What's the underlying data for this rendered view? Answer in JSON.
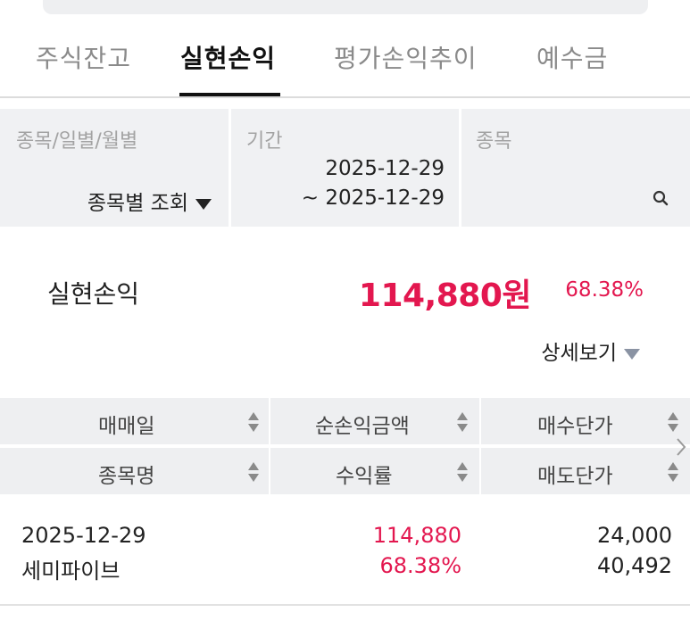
{
  "tabs": [
    {
      "label": "주식잔고",
      "active": false
    },
    {
      "label": "실현손익",
      "active": true
    },
    {
      "label": "평가손익추이",
      "active": false
    },
    {
      "label": "예수금",
      "active": false
    }
  ],
  "filters": {
    "view_type": {
      "label": "종목/일별/월별",
      "value": "종목별 조회"
    },
    "period": {
      "label": "기간",
      "start": "2025-12-29",
      "end": "~ 2025-12-29"
    },
    "stock": {
      "label": "종목",
      "search_icon": "search-icon"
    }
  },
  "summary": {
    "label": "실현손익",
    "amount": "114,880원",
    "rate": "68.38%",
    "detail_label": "상세보기"
  },
  "table": {
    "header_row1": [
      "매매일",
      "순손익금액",
      "매수단가"
    ],
    "header_row2": [
      "종목명",
      "수익률",
      "매도단가"
    ],
    "rows": [
      {
        "date": "2025-12-29",
        "name": "세미파이브",
        "net_profit": "114,880",
        "rate": "68.38%",
        "buy_price": "24,000",
        "sell_price": "40,492"
      }
    ]
  },
  "colors": {
    "accent_red": "#e3174f",
    "header_bg": "#eeeff1",
    "filter_bg": "#f0f1f3"
  }
}
